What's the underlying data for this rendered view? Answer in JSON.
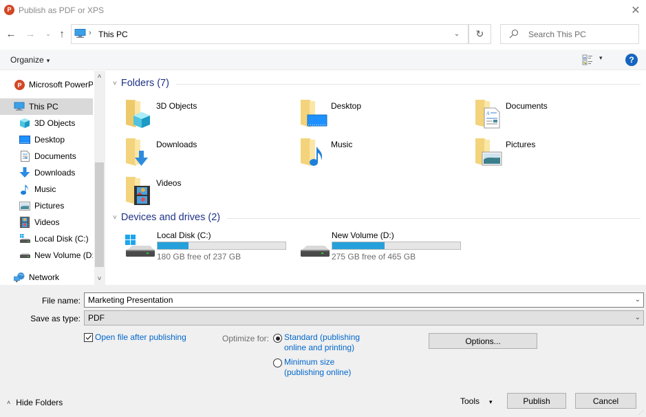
{
  "window": {
    "title": "Publish as PDF or XPS",
    "app_icon_letter": "P",
    "close_symbol": "✕"
  },
  "navigation": {
    "back": "←",
    "forward": "→",
    "recent": "⌄",
    "up": "↑",
    "address": {
      "separator": "›",
      "location": "This PC",
      "dropdown": "⌄",
      "refresh": "↻"
    },
    "search": {
      "placeholder": "Search This PC"
    }
  },
  "toolbar": {
    "organize_label": "Organize",
    "caret": "▾",
    "view_caret": "▾",
    "help_label": "?"
  },
  "sidebar": {
    "items": [
      {
        "label": "Microsoft PowerP",
        "icon": "powerpoint-icon"
      },
      {
        "label": "This PC",
        "icon": "this-pc-icon",
        "selected": true
      },
      {
        "label": "3D Objects",
        "icon": "3d-objects-icon"
      },
      {
        "label": "Desktop",
        "icon": "desktop-icon"
      },
      {
        "label": "Documents",
        "icon": "documents-icon"
      },
      {
        "label": "Downloads",
        "icon": "downloads-icon"
      },
      {
        "label": "Music",
        "icon": "music-icon"
      },
      {
        "label": "Pictures",
        "icon": "pictures-icon"
      },
      {
        "label": "Videos",
        "icon": "videos-icon"
      },
      {
        "label": "Local Disk (C:)",
        "icon": "local-disk-icon"
      },
      {
        "label": "New Volume (D:)",
        "icon": "drive-icon"
      },
      {
        "label": "Network",
        "icon": "network-icon"
      }
    ],
    "scroll_up": "˄",
    "scroll_down": "˅"
  },
  "content": {
    "folders_group": {
      "title": "Folders (7)",
      "chevron": "˅",
      "items": [
        {
          "name": "3D Objects",
          "icon": "3d-objects-folder-icon"
        },
        {
          "name": "Desktop",
          "icon": "desktop-folder-icon"
        },
        {
          "name": "Documents",
          "icon": "documents-folder-icon"
        },
        {
          "name": "Downloads",
          "icon": "downloads-folder-icon"
        },
        {
          "name": "Music",
          "icon": "music-folder-icon"
        },
        {
          "name": "Pictures",
          "icon": "pictures-folder-icon"
        },
        {
          "name": "Videos",
          "icon": "videos-folder-icon"
        }
      ]
    },
    "drives_group": {
      "title": "Devices and drives (2)",
      "chevron": "˅",
      "items": [
        {
          "name": "Local Disk (C:)",
          "free_text": "180 GB free of 237 GB",
          "used_fraction": 0.24,
          "icon": "windows-drive-icon"
        },
        {
          "name": "New Volume (D:)",
          "free_text": "275 GB free of 465 GB",
          "used_fraction": 0.41,
          "icon": "hard-drive-icon"
        }
      ]
    }
  },
  "form": {
    "file_name_label": "File name:",
    "file_name_value": "Marketing Presentation",
    "save_as_type_label": "Save as type:",
    "save_as_type_value": "PDF",
    "dropdown_arrow": "⌄",
    "open_after_label": "Open file after publishing",
    "open_after_checked": true,
    "optimize_label": "Optimize for:",
    "optimize_options": [
      {
        "line1": "Standard (publishing",
        "line2": "online and printing)",
        "selected": true
      },
      {
        "line1": "Minimum size",
        "line2": "(publishing online)",
        "selected": false
      }
    ],
    "options_button": "Options..."
  },
  "footer": {
    "hide_folders_label": "Hide Folders",
    "hide_chevron": "˄",
    "tools_label": "Tools",
    "tools_caret": "▾",
    "publish_button": "Publish",
    "cancel_button": "Cancel"
  },
  "colors": {
    "accent_link": "#0066cc",
    "group_title": "#1e3287",
    "drive_fill": "#26a0da",
    "selected_bg": "#d9d9d9"
  }
}
